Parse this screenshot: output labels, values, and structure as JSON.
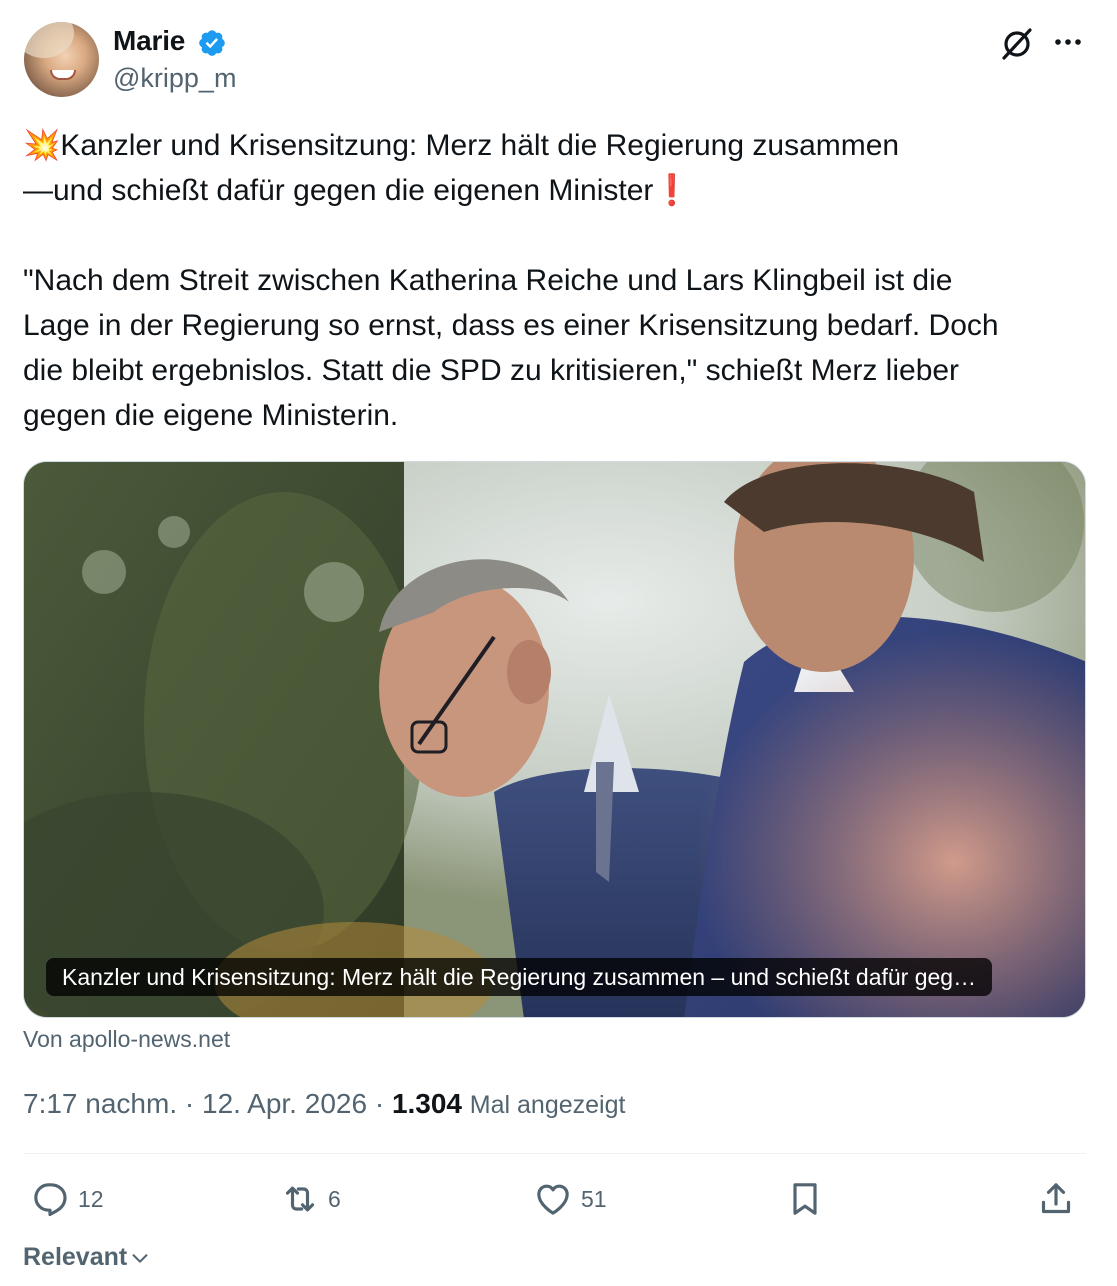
{
  "author": {
    "name": "Marie",
    "handle": "@kripp_m",
    "verified": true,
    "avatar_icon": "profile-photo"
  },
  "header": {
    "grok_icon": "grok-icon",
    "more_icon": "more-icon"
  },
  "tweet": {
    "lines": [
      "💥Kanzler und Krisensitzung: Merz hält die Regierung zusammen",
      "—und schießt dafür gegen die eigenen Minister❗",
      "",
      "\"Nach dem Streit zwischen Katherina Reiche und Lars Klingbeil ist die",
      "Lage in der Regierung so ernst, dass es einer Krisensitzung bedarf. Doch",
      "die bleibt ergebnislos. Statt die SPD zu kritisieren,\" schießt Merz lieber",
      "gegen die eigene Ministerin."
    ]
  },
  "link_card": {
    "caption": "Kanzler und Krisensitzung: Merz hält die Regierung zusammen – und schießt dafür geg…",
    "source": "Von apollo-news.net"
  },
  "meta": {
    "time": "7:17 nachm.",
    "separator": "·",
    "date": "12. Apr. 2026",
    "views": "1.304",
    "views_label": "Mal angezeigt"
  },
  "actions": {
    "replies": "12",
    "reposts": "6",
    "likes": "51"
  },
  "sort": {
    "label": "Relevant"
  },
  "colors": {
    "text": "#0f1419",
    "secondary": "#536471",
    "verified": "#1d9bf0",
    "border": "#cfd9de"
  }
}
